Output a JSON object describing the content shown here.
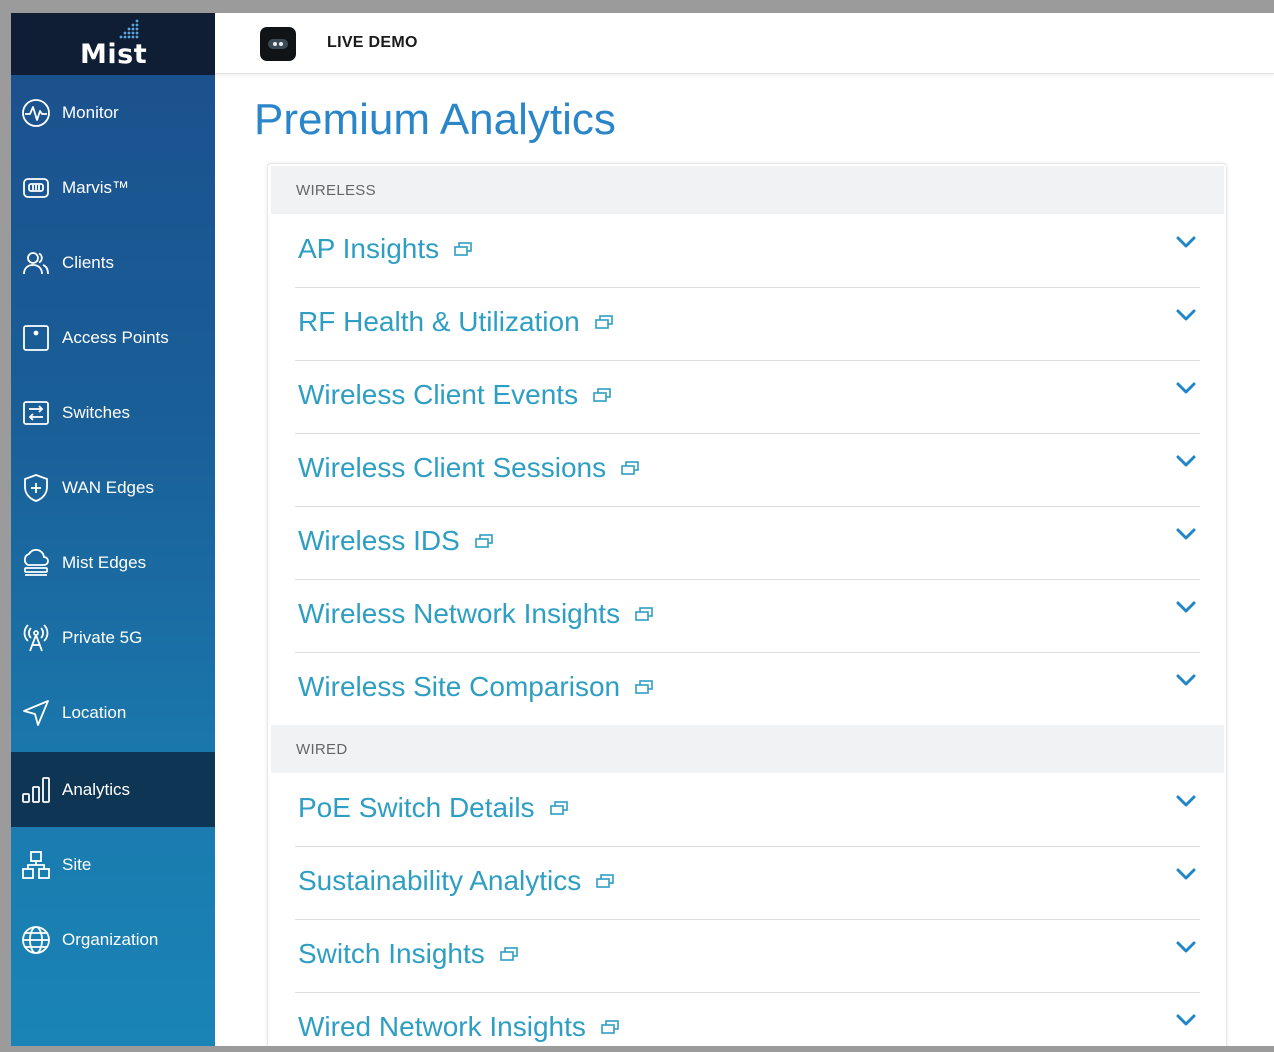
{
  "logo": {
    "text": "Mist"
  },
  "header": {
    "demo_label": "LIVE DEMO"
  },
  "sidebar": {
    "items": [
      {
        "label": "Monitor",
        "icon": "monitor-icon"
      },
      {
        "label": "Marvis™",
        "icon": "marvis-icon"
      },
      {
        "label": "Clients",
        "icon": "clients-icon"
      },
      {
        "label": "Access Points",
        "icon": "access-point-icon"
      },
      {
        "label": "Switches",
        "icon": "switch-icon"
      },
      {
        "label": "WAN Edges",
        "icon": "wan-edge-icon"
      },
      {
        "label": "Mist Edges",
        "icon": "mist-edge-icon"
      },
      {
        "label": "Private 5G",
        "icon": "antenna-icon"
      },
      {
        "label": "Location",
        "icon": "location-icon"
      },
      {
        "label": "Analytics",
        "icon": "analytics-icon",
        "active": true
      },
      {
        "label": "Site",
        "icon": "site-icon"
      },
      {
        "label": "Organization",
        "icon": "globe-icon"
      }
    ]
  },
  "page": {
    "title": "Premium Analytics"
  },
  "sections": [
    {
      "header": "WIRELESS",
      "items": [
        "AP Insights",
        "RF Health & Utilization",
        "Wireless Client Events",
        "Wireless Client Sessions",
        "Wireless IDS",
        "Wireless Network Insights",
        "Wireless Site Comparison"
      ]
    },
    {
      "header": "WIRED",
      "items": [
        "PoE Switch Details",
        "Sustainability Analytics",
        "Switch Insights",
        "Wired Network Insights"
      ]
    }
  ],
  "colors": {
    "accent_title": "#2a86c9",
    "row_link": "#2e9ec3",
    "chevron": "#1f86c7",
    "sidebar_active": "#0f3554"
  }
}
